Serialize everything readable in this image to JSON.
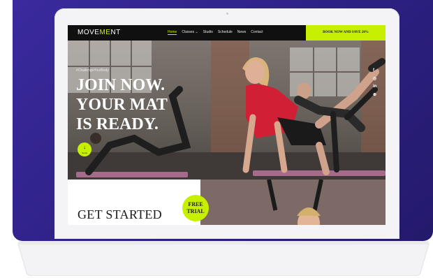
{
  "brand": {
    "logo_pre": "MOVE",
    "logo_accent": "ME",
    "logo_post": "NT"
  },
  "nav": {
    "items": [
      "Home",
      "Classes ⌄",
      "Studio",
      "Schedule",
      "News",
      "Contact"
    ],
    "cta": "BOOK NOW AND SAVE 20%"
  },
  "hero": {
    "tagline": "#ChallengeYourBody",
    "headline": [
      "JOIN NOW.",
      "YOUR MAT",
      "IS READY."
    ],
    "scroll_arrow": "↓",
    "scroll_label": "Scroll"
  },
  "social": [
    "f",
    "◎",
    "in",
    "⊕"
  ],
  "lower": {
    "get_started": "GET STARTED",
    "badge_line1": "FREE",
    "badge_line2": "TRIAL"
  },
  "colors": {
    "accent": "#c6f000",
    "backdrop": "#2b1f7f"
  }
}
